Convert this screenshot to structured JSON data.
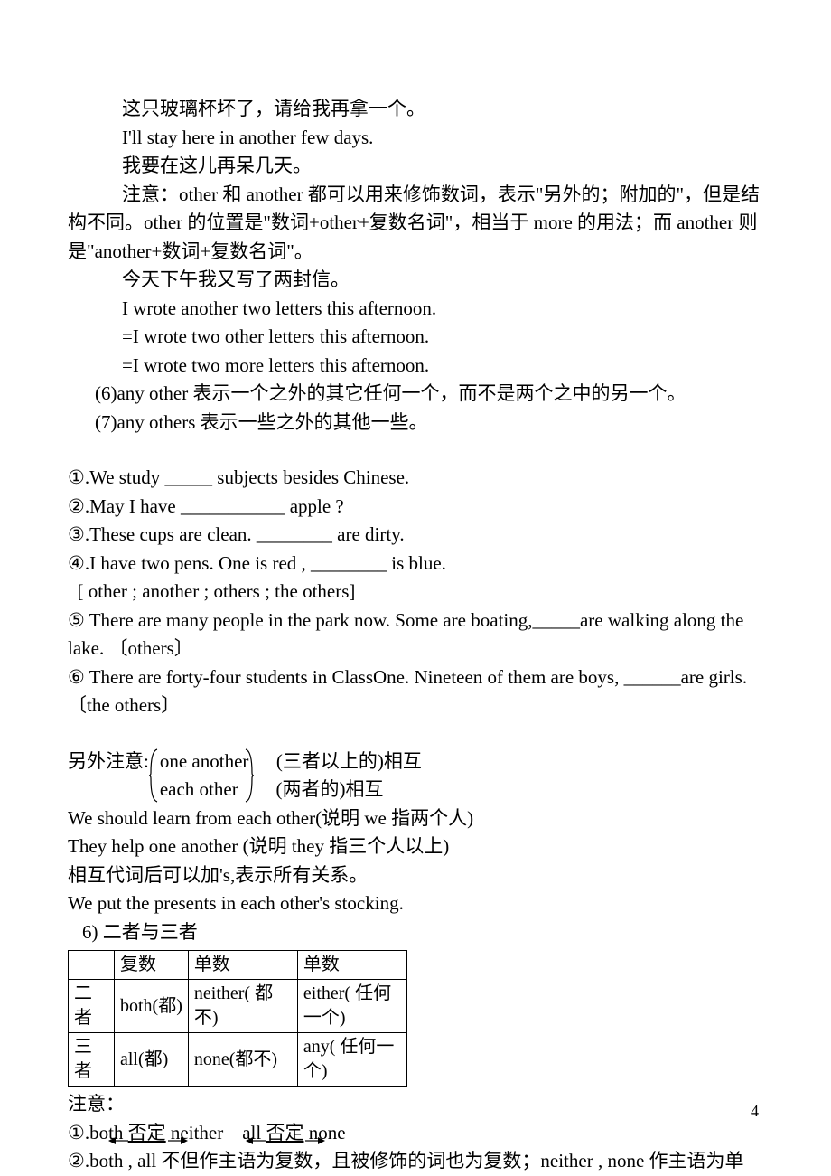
{
  "lines": {
    "l1": "这只玻璃杯坏了，请给我再拿一个。",
    "l2": "I'll stay here in another few days.",
    "l3": "我要在这儿再呆几天。",
    "l4": "注意：other 和 another 都可以用来修饰数词，表示\"另外的；附加的\"，但是结构不同。other 的位置是\"数词+other+复数名词\"，相当于 more 的用法；而 another 则是\"another+数词+复数名词\"。",
    "l5": "今天下午我又写了两封信。",
    "l6": "I wrote another two letters this afternoon.",
    "l7": "=I wrote two other letters this afternoon.",
    "l8": "=I wrote two more letters this afternoon.",
    "l9": "(6)any other   表示一个之外的其它任何一个，而不是两个之中的另一个。",
    "l10": "(7)any others  表示一些之外的其他一些。",
    "q1": "①.We study _____ subjects besides Chinese.",
    "q2": "②.May I have ___________ apple ?",
    "q3": "③.These cups are clean. ________ are dirty.",
    "q4": "④.I have two pens. One is red , ________ is blue.",
    "q4b": "  [ other ; another ; others ; the others]",
    "q5": "⑤  There are many people in the park now. Some are boating,_____are walking along the lake.  〔others〕",
    "q6": "⑥  There are forty-four students in ClassOne. Nineteen of them are boys, ______are girls.〔the others〕",
    "note_pre": "另外注意:",
    "bracket_a": "one another",
    "bracket_a2": "(三者以上的)相互",
    "bracket_b": "each other",
    "bracket_b2": "(两者的)相互",
    "s1": "We should learn from each other(说明 we 指两个人)",
    "s2": "They help one another (说明 they 指三个人以上)",
    "s3": "相互代词后可以加's,表示所有关系。",
    "s4": "We put the presents in each other's stocking.",
    "sec6": "6)  二者与三者",
    "after1a": "注意：",
    "after1b_pre": "①.both ",
    "after1b_neg": "否定",
    "after1b_mid": " neither    all ",
    "after1b_neg2": "否定",
    "after1b_end": " none",
    "after2": "②.both , all  不但作主语为复数，且被修饰的词也为复数；neither , none 作主语为单"
  },
  "table": {
    "h1": " ",
    "h2": "复数",
    "h3": "单数",
    "h4": "单数",
    "r1c1": "二者",
    "r1c2": "both(都)",
    "r1c3": "neither( 都不)",
    "r1c4": "either( 任何一个)",
    "r2c1": "三者",
    "r2c2": "all(都)",
    "r2c3": "none(都不)",
    "r2c4": "any( 任何一个)"
  },
  "pagenum": "4"
}
